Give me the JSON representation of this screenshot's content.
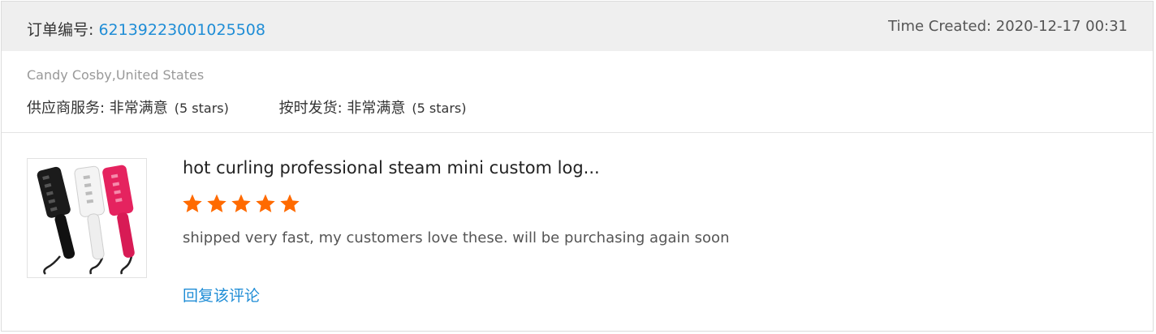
{
  "order": {
    "label": "订单编号: ",
    "number": "62139223001025508",
    "time_created": "Time Created: 2020-12-17 00:31"
  },
  "buyer": {
    "name_country": "Candy Cosby,United States"
  },
  "ratings": [
    {
      "label": "供应商服务: 非常满意",
      "stars_text": "(5 stars)"
    },
    {
      "label": "按时发货: 非常满意",
      "stars_text": "(5 stars)"
    }
  ],
  "review": {
    "product_title": "hot curling professional steam mini custom log...",
    "rating": 5,
    "rating_max": 5,
    "star_color": "#ff6a00",
    "text": "shipped very fast, my customers love these. will be purchasing again soon",
    "reply_label": "回复该评论",
    "thumbnail_icon": "hair-straightener-product-image"
  },
  "colors": {
    "accent_link": "#1f8dd6",
    "header_bg": "#efefef"
  }
}
